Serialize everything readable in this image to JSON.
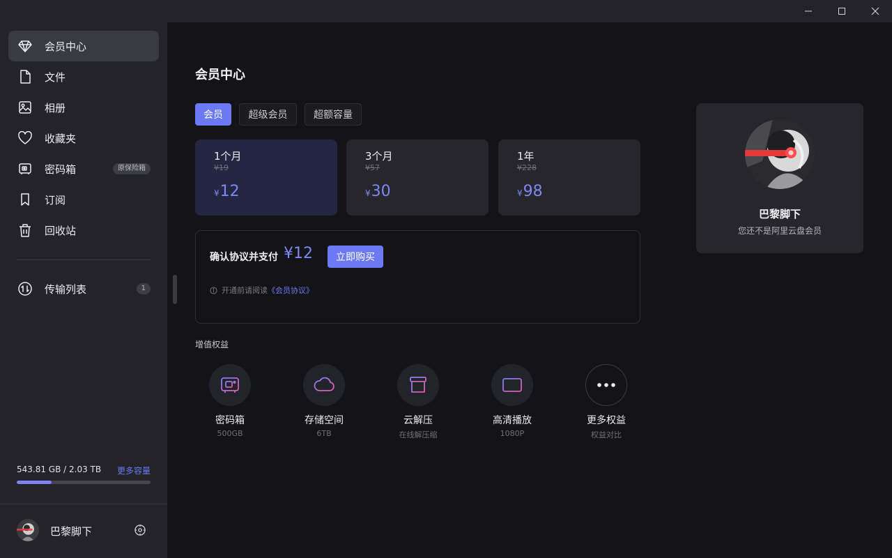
{
  "window": {
    "controls": {
      "minimize_icon": "minimize-icon",
      "maximize_icon": "maximize-icon",
      "close_icon": "close-icon"
    }
  },
  "sidebar": {
    "items": [
      {
        "label": "会员中心",
        "icon": "diamond-icon",
        "active": true
      },
      {
        "label": "文件",
        "icon": "file-icon"
      },
      {
        "label": "相册",
        "icon": "photo-icon"
      },
      {
        "label": "收藏夹",
        "icon": "heart-icon"
      },
      {
        "label": "密码箱",
        "icon": "safe-icon",
        "badge": "原保险箱"
      },
      {
        "label": "订阅",
        "icon": "bookmark-icon"
      },
      {
        "label": "回收站",
        "icon": "trash-icon"
      }
    ],
    "transfer": {
      "label": "传输列表",
      "icon": "transfer-icon",
      "badge": "1"
    },
    "storage": {
      "text": "543.81 GB / 2.03 TB",
      "more": "更多容量",
      "used_fraction": 0.26
    },
    "user": {
      "name": "巴黎脚下",
      "settings_icon": "settings-icon"
    }
  },
  "main": {
    "title": "会员中心",
    "tabs": [
      {
        "label": "会员",
        "active": true
      },
      {
        "label": "超级会员"
      },
      {
        "label": "超额容量"
      }
    ],
    "plans": [
      {
        "name": "1个月",
        "original": "¥19",
        "currency": "¥",
        "price": "12",
        "selected": true
      },
      {
        "name": "3个月",
        "original": "¥57",
        "currency": "¥",
        "price": "30"
      },
      {
        "name": "1年",
        "original": "¥228",
        "currency": "¥",
        "price": "98"
      }
    ],
    "payment": {
      "label": "确认协议并支付",
      "price": "¥12",
      "buy_button": "立即购买",
      "notice_prefix": "开通前请阅读",
      "notice_link": "《会员协议》"
    },
    "perks_label": "增值权益",
    "perks": [
      {
        "title": "密码箱",
        "sub": "500GB",
        "icon": "safe-icon"
      },
      {
        "title": "存储空间",
        "sub": "6TB",
        "icon": "cloud-icon"
      },
      {
        "title": "云解压",
        "sub": "在线解压缩",
        "icon": "archive-icon"
      },
      {
        "title": "高清播放",
        "sub": "1080P",
        "icon": "card-icon"
      },
      {
        "title": "更多权益",
        "sub": "权益对比",
        "icon": "more-icon"
      }
    ]
  },
  "profile": {
    "name": "巴黎脚下",
    "status": "您还不是阿里云盘会员"
  },
  "colors": {
    "accent": "#6b79f2",
    "price": "#7d88f5",
    "sidebar_bg": "#232329",
    "main_bg": "#141418",
    "card_bg": "#26262c"
  }
}
